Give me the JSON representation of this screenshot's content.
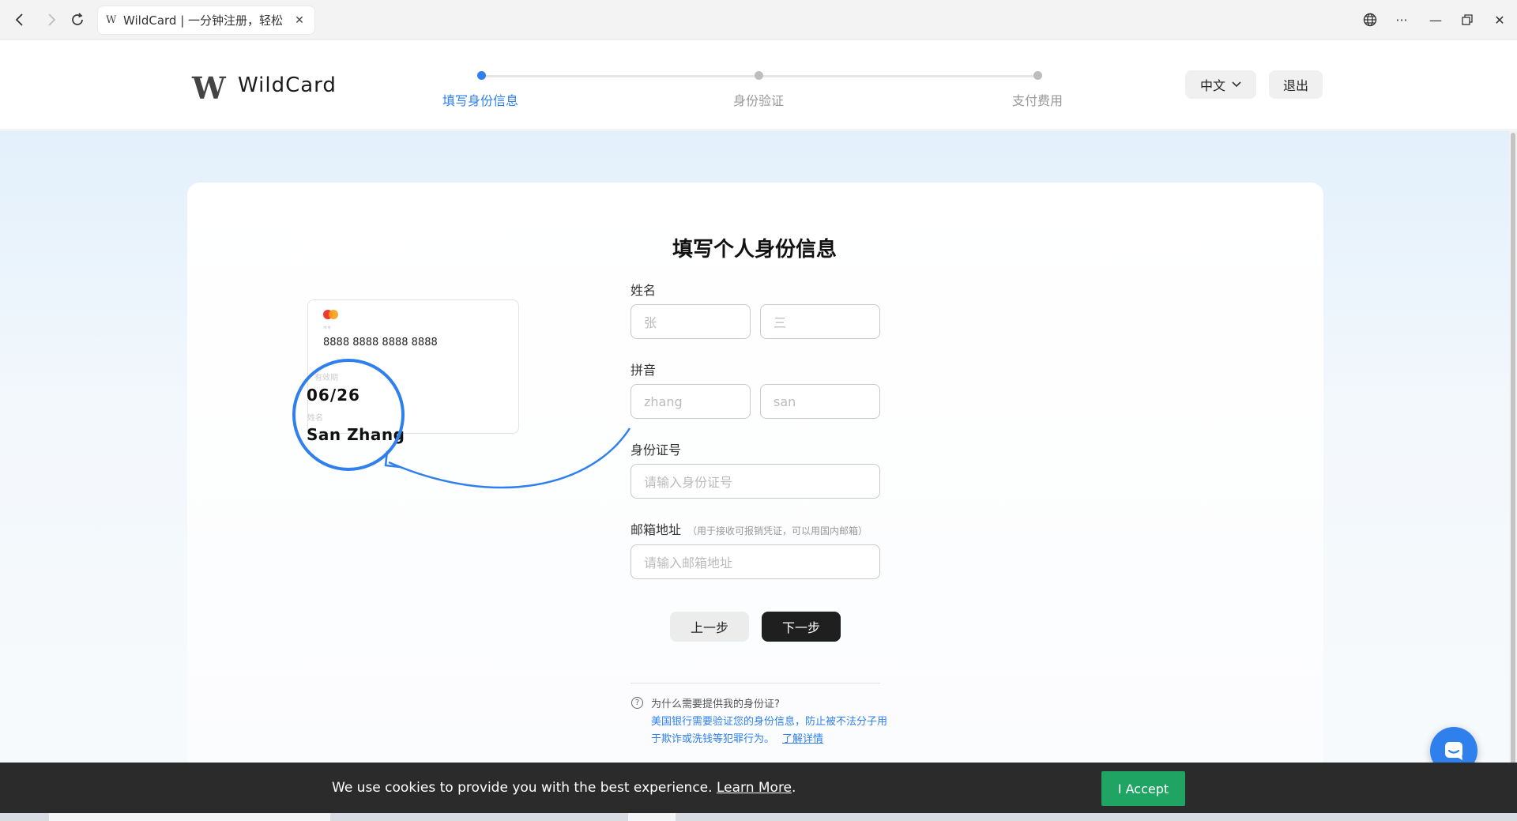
{
  "browser": {
    "tab_favicon": "W",
    "tab_title": "WildCard | 一分钟注册，轻松",
    "icons": [
      "back-icon",
      "forward-icon",
      "reload-icon",
      "close-icon",
      "translate-icon",
      "more-icon",
      "minimize-icon",
      "restore-icon",
      "window-close-icon"
    ]
  },
  "header": {
    "logo_mark": "W",
    "logo_text": "WildCard",
    "steps": [
      {
        "label": "填写身份信息",
        "state": "active"
      },
      {
        "label": "身份验证",
        "state": "pending"
      },
      {
        "label": "支付费用",
        "state": "pending"
      }
    ],
    "language": "中文",
    "logout": "退出"
  },
  "illustration": {
    "card_number": "8888 8888 8888 8888",
    "expiry_label": "有效期",
    "expiry": "06/26",
    "name_label": "姓名",
    "name": "San Zhang"
  },
  "form": {
    "title": "填写个人身份信息",
    "name_label": "姓名",
    "surname_placeholder": "张",
    "given_name_placeholder": "三",
    "pinyin_label": "拼音",
    "pinyin_surname_placeholder": "zhang",
    "pinyin_given_placeholder": "san",
    "id_label": "身份证号",
    "id_placeholder": "请输入身份证号",
    "email_label": "邮箱地址",
    "email_hint": "（用于接收可报销凭证，可以用国内邮箱）",
    "email_placeholder": "请输入邮箱地址",
    "prev_button": "上一步",
    "next_button": "下一步"
  },
  "help": {
    "question": "为什么需要提供我的身份证?",
    "answer": "美国银行需要验证您的身份信息，防止被不法分子用于欺诈或洗钱等犯罪行为。",
    "link": "了解详情"
  },
  "cookie": {
    "text": "We use cookies to provide you with the best experience.",
    "link": "Learn More",
    "suffix": ".",
    "accept": "I Accept"
  },
  "colors": {
    "accent": "#2f80ed",
    "accept_green": "#1fa463",
    "dark_button": "#1f1f1f"
  }
}
